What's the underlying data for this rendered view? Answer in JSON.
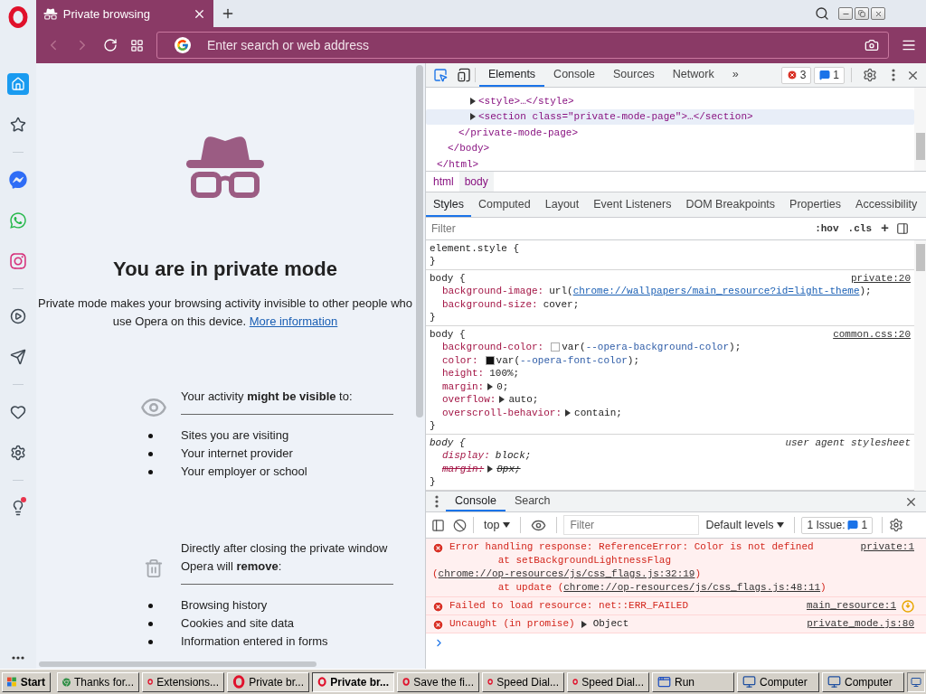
{
  "browser": {
    "tabs": [
      {
        "title": "Private browsing",
        "selected": true
      }
    ],
    "address_bar": {
      "placeholder": "Enter search or web address"
    }
  },
  "sidebar": {
    "items": [
      {
        "kind": "home",
        "selected": true
      },
      {
        "kind": "bookmarks",
        "selected": false
      },
      {
        "kind": "divider"
      },
      {
        "kind": "messenger",
        "selected": false
      },
      {
        "kind": "whatsapp",
        "selected": false
      },
      {
        "kind": "instagram",
        "selected": false
      },
      {
        "kind": "divider"
      },
      {
        "kind": "player",
        "selected": false
      },
      {
        "kind": "flow",
        "selected": false
      },
      {
        "kind": "divider"
      },
      {
        "kind": "heart",
        "selected": false
      },
      {
        "kind": "settings",
        "selected": false
      },
      {
        "kind": "divider"
      },
      {
        "kind": "tips",
        "selected": false,
        "badge": true
      }
    ]
  },
  "page": {
    "heading": "You are in private mode",
    "intro": "Private mode makes your browsing activity invisible to other people who use Opera on this device.",
    "link": "More information",
    "sections": [
      {
        "kind": "visibility",
        "title": "Your activity **might be visible** to:",
        "items": [
          "Sites you are visiting",
          "Your internet provider",
          "Your employer or school"
        ]
      },
      {
        "kind": "removal",
        "title": "Directly after closing the private window Opera will **remove**:",
        "items": [
          "Browsing history",
          "Cookies and site data",
          "Information entered in forms"
        ]
      }
    ]
  },
  "devtools": {
    "tabs": [
      {
        "label": "Elements",
        "selected": true
      },
      {
        "label": "Console",
        "selected": false
      },
      {
        "label": "Sources",
        "selected": false
      },
      {
        "label": "Network",
        "selected": false
      }
    ],
    "more": "»",
    "error_count": "3",
    "message_count": "1",
    "dom_tree": {
      "closing": "</html>",
      "children": [
        {
          "closing": "</body>",
          "children": [
            {
              "closing": "</private-mode-page>",
              "children": [
                {
                  "text": "<style>…</style>",
                  "collapsed": true,
                  "selected": false
                },
                {
                  "text": "<section class=\"private-mode-page\">…</section>",
                  "collapsed": true,
                  "selected": true
                }
              ]
            }
          ]
        }
      ]
    },
    "breadcrumbs": [
      {
        "label": "html",
        "selected": false
      },
      {
        "label": "body",
        "selected": true
      }
    ],
    "panel_tabs": [
      {
        "label": "Styles",
        "selected": true
      },
      {
        "label": "Computed",
        "selected": false
      },
      {
        "label": "Layout",
        "selected": false
      },
      {
        "label": "Event Listeners",
        "selected": false
      },
      {
        "label": "DOM Breakpoints",
        "selected": false
      },
      {
        "label": "Properties",
        "selected": false
      },
      {
        "label": "Accessibility",
        "selected": false
      }
    ],
    "styles_filter": {
      "placeholder": "Filter"
    },
    "hov": ":hov",
    "cls": ".cls",
    "add": "+",
    "rules": [
      {
        "selector": "element.style {",
        "close": "}",
        "user_agent": false
      },
      {
        "selector": "body {",
        "close": "}",
        "source": "private:20",
        "user_agent": false,
        "declarations": [
          {
            "property": "background-image:",
            "expandable": false,
            "overridden": false,
            "value": [
              {
                "kind": "plain",
                "text": "url("
              },
              {
                "kind": "link",
                "text": "chrome://wallpapers/main_resource?id=light-theme"
              },
              {
                "kind": "plain",
                "text": ");"
              }
            ]
          },
          {
            "property": "background-size:",
            "expandable": false,
            "overridden": false,
            "value": [
              {
                "kind": "plain",
                "text": "cover;"
              }
            ]
          }
        ]
      },
      {
        "selector": "body {",
        "close": "}",
        "source": "common.css:20",
        "user_agent": false,
        "declarations": [
          {
            "property": "background-color:",
            "color": "#ffffff",
            "expandable": false,
            "overridden": false,
            "value": [
              {
                "kind": "plain",
                "text": "var("
              },
              {
                "kind": "variable",
                "text": "--opera-background-color"
              },
              {
                "kind": "plain",
                "text": ");"
              }
            ]
          },
          {
            "property": "color:",
            "color": "#111111",
            "expandable": false,
            "overridden": false,
            "value": [
              {
                "kind": "plain",
                "text": "var("
              },
              {
                "kind": "variable",
                "text": "--opera-font-color"
              },
              {
                "kind": "plain",
                "text": ");"
              }
            ]
          },
          {
            "property": "height:",
            "expandable": false,
            "overridden": false,
            "value": [
              {
                "kind": "plain",
                "text": "100%;"
              }
            ]
          },
          {
            "property": "margin:",
            "expandable": true,
            "overridden": false,
            "value": [
              {
                "kind": "plain",
                "text": "0;"
              }
            ]
          },
          {
            "property": "overflow:",
            "expandable": true,
            "overridden": false,
            "value": [
              {
                "kind": "plain",
                "text": "auto;"
              }
            ]
          },
          {
            "property": "overscroll-behavior:",
            "expandable": true,
            "overridden": false,
            "value": [
              {
                "kind": "plain",
                "text": "contain;"
              }
            ]
          }
        ]
      },
      {
        "selector": "body {",
        "close": "}",
        "source": "user agent stylesheet",
        "user_agent": true,
        "declarations": [
          {
            "property": "display:",
            "expandable": false,
            "overridden": false,
            "value": [
              {
                "kind": "plain",
                "text": "block;"
              }
            ]
          },
          {
            "property": "margin:",
            "expandable": true,
            "overridden": true,
            "value": [
              {
                "kind": "plain",
                "text": "8px;"
              }
            ]
          }
        ]
      }
    ],
    "drawer": {
      "tabs": [
        {
          "label": "Console",
          "selected": true
        },
        {
          "label": "Search",
          "selected": false
        }
      ],
      "context": "top",
      "filter": {
        "placeholder": "Filter"
      },
      "levels": "Default levels",
      "issues_label": "1 Issue:",
      "issues_count": "1",
      "messages": [
        {
          "kind": "error",
          "text": "Error handling response: ReferenceError: Color is not defined",
          "source": "private:1",
          "issue": false,
          "stack": [
            {
              "text": "at setBackgroundLightnessFlag (",
              "link": "chrome://op-resources/js/css_flags.js:32:19",
              "end": ")"
            },
            {
              "text": "at update (",
              "link": "chrome://op-resources/js/css_flags.js:48:11",
              "end": ")"
            }
          ]
        },
        {
          "kind": "error",
          "text": "Failed to load resource: net::ERR_FAILED",
          "source": "main_resource:1",
          "issue": true
        },
        {
          "kind": "error",
          "text": "Uncaught (in promise)",
          "object": "Object",
          "source": "private_mode.js:80",
          "issue": false
        }
      ]
    }
  },
  "taskbar": {
    "start": "Start",
    "items": [
      {
        "kind": "chrome",
        "label": "Thanks for...",
        "selected": false
      },
      {
        "kind": "opera",
        "label": "Extensions...",
        "selected": false
      },
      {
        "kind": "opera",
        "label": "Private br...",
        "selected": false
      },
      {
        "kind": "opera",
        "label": "Private br...",
        "selected": true
      },
      {
        "kind": "opera",
        "label": "Save the fi...",
        "selected": false
      },
      {
        "kind": "opera",
        "label": "Speed Dial...",
        "selected": false
      },
      {
        "kind": "opera",
        "label": "Speed Dial...",
        "selected": false
      },
      {
        "kind": "run",
        "label": "Run",
        "selected": false
      },
      {
        "kind": "computer",
        "label": "Computer",
        "selected": false
      },
      {
        "kind": "computer",
        "label": "Computer",
        "selected": false
      }
    ]
  }
}
